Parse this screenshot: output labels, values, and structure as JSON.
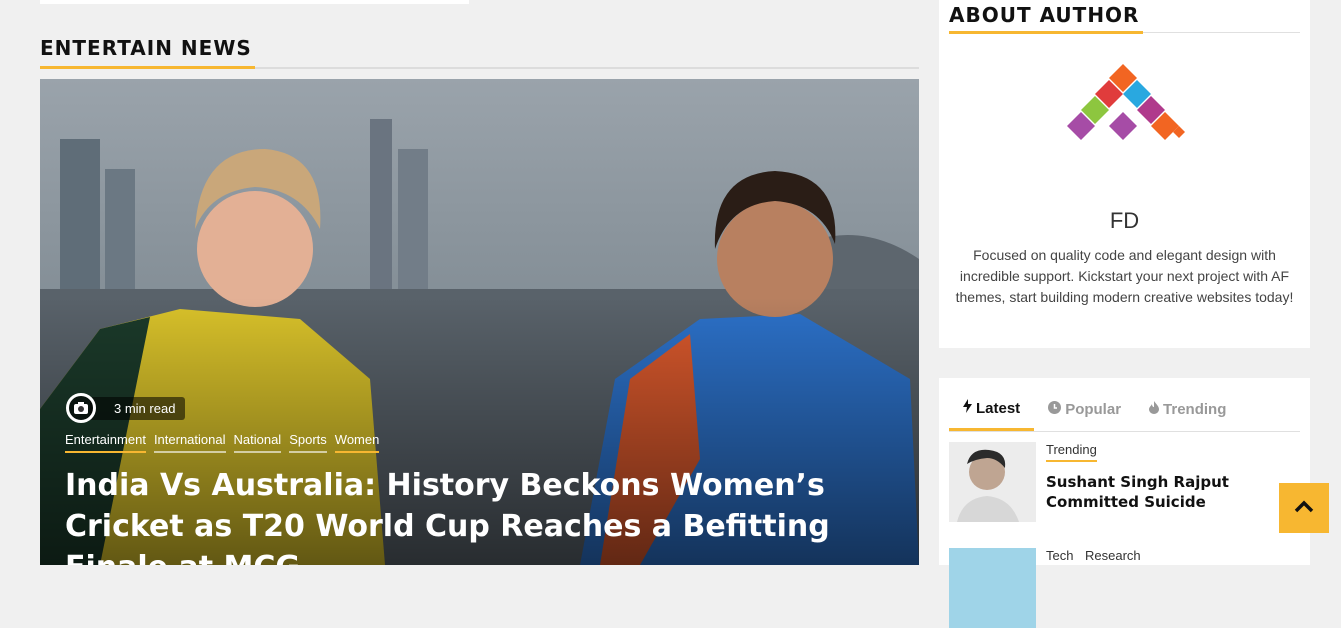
{
  "section": {
    "title": "ENTERTAIN NEWS"
  },
  "hero": {
    "read_time": "3 min read",
    "categories": [
      "Entertainment",
      "International",
      "National",
      "Sports",
      "Women"
    ],
    "title": "India Vs Australia: History Beckons Women’s Cricket as T20 World Cup Reaches a Befitting Finale at MCG",
    "camera_icon": "camera-icon"
  },
  "about": {
    "title": "ABOUT AUTHOR",
    "name": "FD",
    "bio": "Focused on quality code and elegant design with incredible support. Kickstart your next project with AF themes, start building modern creative websites today!"
  },
  "tabs": {
    "items": [
      {
        "label": "Latest",
        "icon": "bolt-icon"
      },
      {
        "label": "Popular",
        "icon": "clock-icon"
      },
      {
        "label": "Trending",
        "icon": "flame-icon"
      }
    ],
    "active": "Latest"
  },
  "latest": [
    {
      "category": "Trending",
      "title": "Sushant Singh Rajput Committed Suicide"
    },
    {
      "categories": [
        "Tech",
        "Research"
      ]
    }
  ],
  "colors": {
    "accent": "#f7b731",
    "background": "#f0f0f0"
  }
}
